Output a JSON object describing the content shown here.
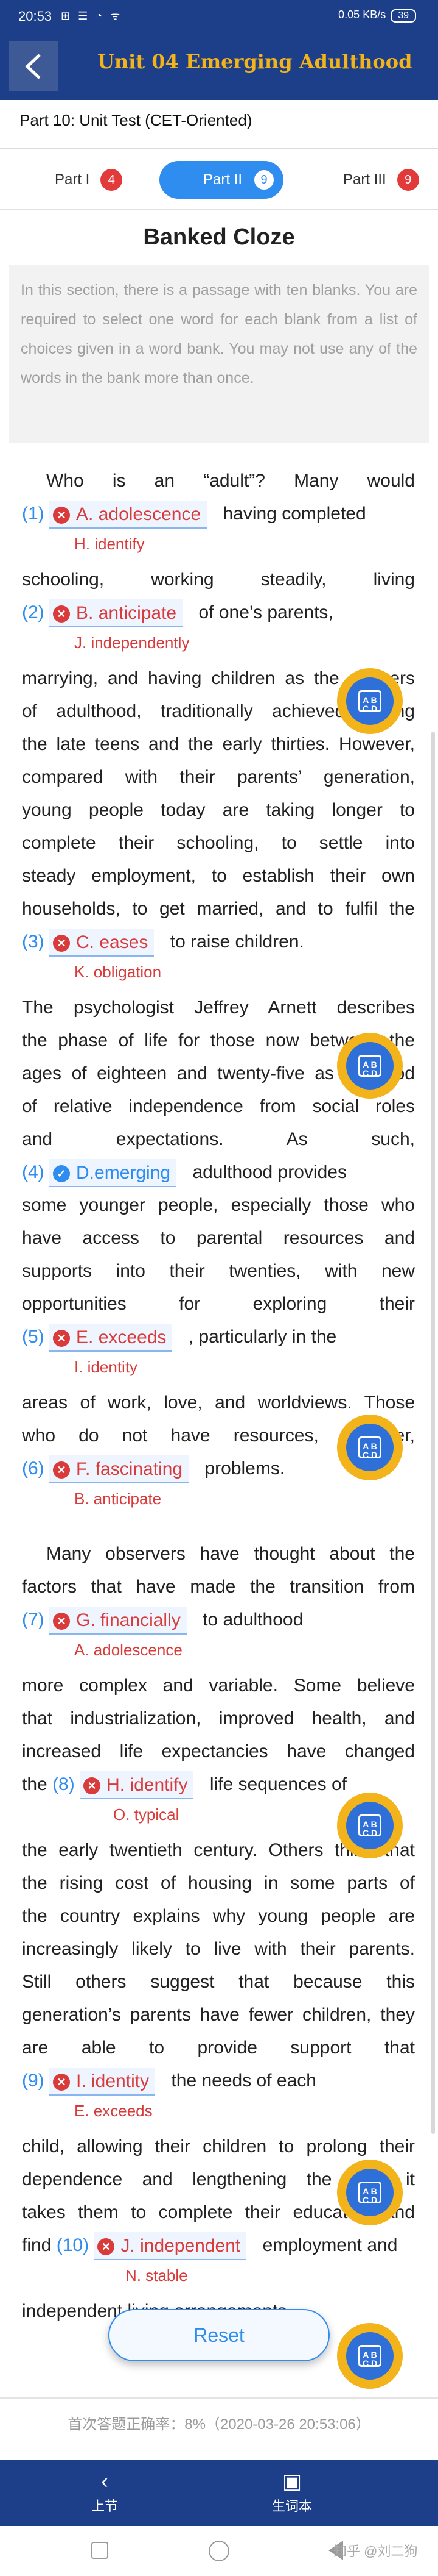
{
  "status_bar": {
    "time": "20:53",
    "icons": "⊞ ☰ ◔ ᯤ",
    "net": "0.05 KB/s",
    "battery": "39"
  },
  "header": {
    "back_label": "",
    "title": "Unit 04 Emerging Adulthood"
  },
  "subheader": {
    "text": "Part 10: Unit Test (CET-Oriented)"
  },
  "tabs": [
    {
      "label": "Part I",
      "count": "4"
    },
    {
      "label": "Part II",
      "count": "9"
    },
    {
      "label": "Part III",
      "count": "9"
    }
  ],
  "section_title": "Banked Cloze",
  "instructions": "In this section, there is a passage with ten blanks. You are required to select one word for each blank from a list of choices given in a word bank. You may not use any of the words in the bank more than once.",
  "passage": {
    "p1_line1": [
      "Who",
      "is",
      "an",
      "“adult”?",
      "Many",
      "would"
    ],
    "blanks": [
      {
        "num": "(1)",
        "answer": "A. adolescence",
        "after": "having completed",
        "correct": "H. identify",
        "status": "wrong"
      },
      {
        "num": "(2)",
        "answer": "B. anticipate",
        "after": "of one’s parents,",
        "correct": "J. independently",
        "status": "wrong"
      },
      {
        "num": "(3)",
        "answer": "C. eases",
        "after": "to raise children.",
        "correct": "K. obligation",
        "status": "wrong"
      },
      {
        "num": "(4)",
        "answer": "D.emerging",
        "after": "adulthood provides",
        "correct": "",
        "status": "right"
      },
      {
        "num": "(5)",
        "answer": "E. exceeds",
        "after": ", particularly in the",
        "correct": "I. identity",
        "status": "wrong"
      },
      {
        "num": "(6)",
        "answer": "F. fascinating",
        "after": "problems.",
        "correct": "B. anticipate",
        "status": "wrong"
      },
      {
        "num": "(7)",
        "answer": "G. financially",
        "after": "to adulthood",
        "correct": "A. adolescence",
        "status": "wrong"
      },
      {
        "num": "(8)",
        "answer": "H. identify",
        "after": "life sequences of",
        "correct": "O. typical",
        "status": "wrong"
      },
      {
        "num": "(9)",
        "answer": "I. identity",
        "after": "the needs of each",
        "correct": "E. exceeds",
        "status": "wrong"
      },
      {
        "num": "(10)",
        "answer": "J. independent",
        "after": "employment and",
        "correct": "N. stable",
        "status": "wrong"
      }
    ],
    "b1_pre": "",
    "l_schooling": "schooling, working steadily, living",
    "l_marrying": "marrying, and having children as the markers",
    "l_adulthood": "of adulthood, traditionally achieved during",
    "l_teens": "the late teens and the early thirties. However,",
    "l_compared": "compared with their parents’ generation,",
    "l_young": "young people today are taking longer to",
    "l_complete": "complete their schooling, to settle into",
    "l_steady": "steady employment, to establish their own",
    "l_households": "households, to get married, and to fulfil the",
    "l_psych": "The psychologist Jeffrey Arnett describes",
    "l_phase": "the phase of life for those now between the",
    "l_ages": "ages of eighteen and twenty-five as a period",
    "l_relative": "of relative independence from social roles",
    "l_expect": "and expectations. As such,",
    "l_some": "some younger people, especially those who",
    "l_access": "have access to parental resources and",
    "l_supports": "supports into their twenties, with new",
    "l_opps": "opportunities for exploring their",
    "l_areas": "areas of work, love, and worldviews. Those",
    "l_who": "who do not have resources, however,",
    "p2_many": "Many observers have thought about the",
    "p2_factors": "factors that have made the transition from",
    "p2_more": "more complex and variable. Some believe",
    "p2_indus": "that industrialization, improved health, and",
    "p2_increased": "increased life expectancies have changed",
    "p2_the": "the",
    "p2_early": "the early twentieth century. Others think that",
    "p2_rising": "the rising cost of housing in some parts of",
    "p2_country": "the country explains why young people are",
    "p2_increasingly": "increasingly likely to live with their parents.",
    "p2_still": "Still others suggest that because this",
    "p2_gen": "generation’s parents have fewer children, they",
    "p2_able": "are able to provide support that",
    "p2_child": "child, allowing their children to prolong their",
    "p2_dep": "dependence and lengthening the time it",
    "p2_takes": "takes them to complete their education and",
    "p2_find": "find",
    "p2_indep": "independent living arrangements."
  },
  "reset_label": "Reset",
  "accuracy": "首次答题正确率：8%（2020-03-26 20:53:06）",
  "bottom_nav": {
    "prev": "上节",
    "vocab": "生词本"
  },
  "watermark": "知乎 @刘二狗",
  "wordbank_icon_text": "A B\nC D",
  "colors": {
    "primary": "#1d3f8a",
    "accent": "#2f8df0",
    "wrong": "#d93a3a",
    "gold": "#f2b31b"
  }
}
